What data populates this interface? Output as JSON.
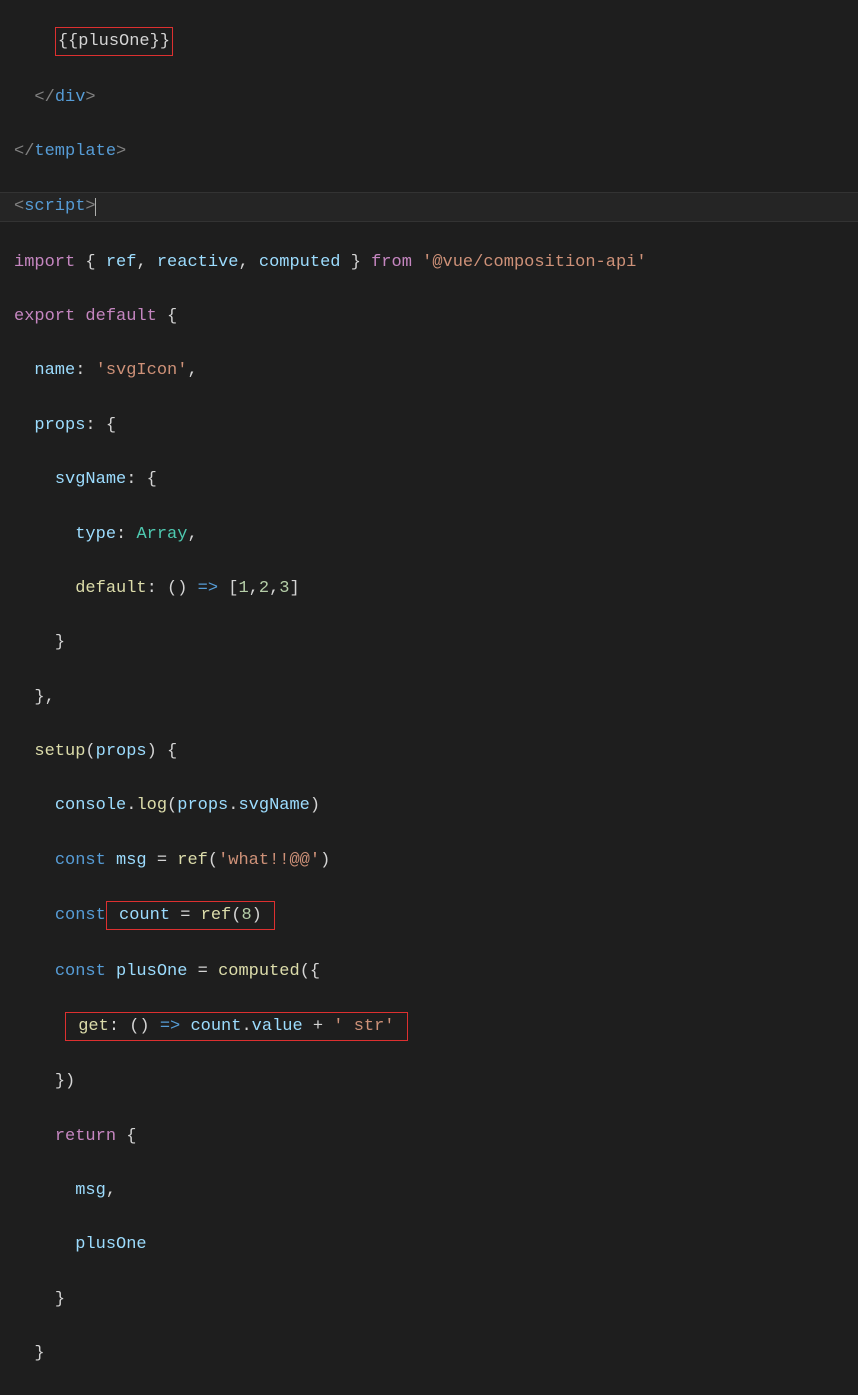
{
  "code": {
    "mustache_left": "{{",
    "mustache_var": "plusOne",
    "mustache_right": "}}",
    "div_close": "div",
    "template_close": "template",
    "script_open": "script",
    "import_kw": "import",
    "import_lb": " { ",
    "import_ref": "ref",
    "import_c1": ", ",
    "import_reactive": "reactive",
    "import_c2": ", ",
    "import_computed": "computed",
    "import_rb": " } ",
    "from_kw": "from",
    "import_path": "'@vue/composition-api'",
    "export_kw": "export",
    "default_kw": "default",
    "name_key": "name",
    "name_val": "'svgIcon'",
    "props_key": "props",
    "svgName_key": "svgName",
    "type_key": "type",
    "type_val": "Array",
    "default_key": "default",
    "default_arr": "[",
    "n1": "1",
    "n2": "2",
    "n3": "3",
    "default_arr_close": "]",
    "setup_fn": "setup",
    "setup_param": "props",
    "console_obj": "console",
    "log_fn": "log",
    "log_inner_obj": "props",
    "log_inner_prop": "svgName",
    "const_kw": "const",
    "msg_var": "msg",
    "ref_fn": "ref",
    "msg_str": "'what!!@@'",
    "count_var": "count",
    "count_num": "8",
    "plusOne_var": "plusOne",
    "computed_fn": "computed",
    "get_key": "get",
    "count_ref": "count",
    "value_prop": "value",
    "concat_str": "' str'",
    "return_kw": "return",
    "ret_msg": "msg",
    "ret_plusOne": "plusOne"
  }
}
